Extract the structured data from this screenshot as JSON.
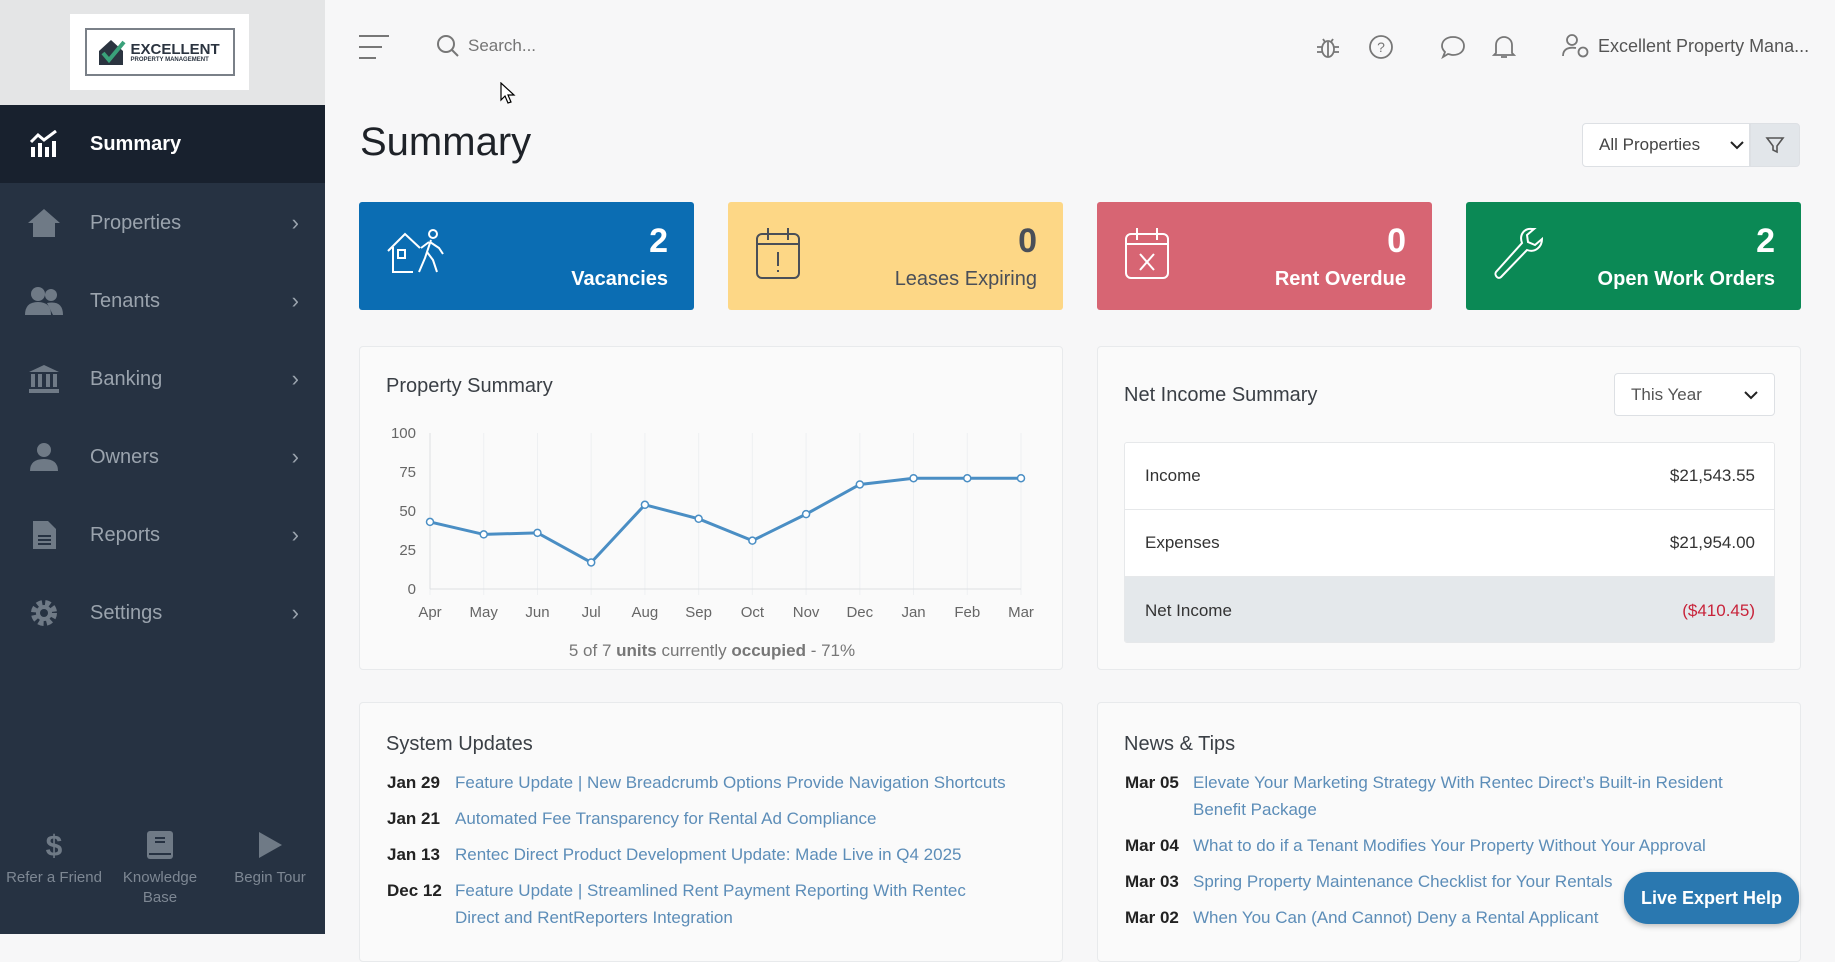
{
  "logo": {
    "line1": "EXCELLENT",
    "line2": "PROPERTY MANAGEMENT"
  },
  "sidebar": {
    "items": [
      {
        "label": "Summary",
        "icon": "chart-icon"
      },
      {
        "label": "Properties",
        "icon": "home-icon"
      },
      {
        "label": "Tenants",
        "icon": "users-icon"
      },
      {
        "label": "Banking",
        "icon": "bank-icon"
      },
      {
        "label": "Owners",
        "icon": "owner-icon"
      },
      {
        "label": "Reports",
        "icon": "document-icon"
      },
      {
        "label": "Settings",
        "icon": "gear-icon"
      }
    ],
    "footer": [
      {
        "label": "Refer a Friend",
        "icon": "dollar-icon"
      },
      {
        "label": "Knowledge Base",
        "icon": "book-icon"
      },
      {
        "label": "Begin Tour",
        "icon": "play-icon"
      }
    ]
  },
  "header": {
    "search_placeholder": "Search...",
    "user": "Excellent Property Mana..."
  },
  "page": {
    "title": "Summary",
    "property_filter": "All Properties"
  },
  "cards": [
    {
      "value": "2",
      "label": "Vacancies",
      "color": "#0b6db3"
    },
    {
      "value": "0",
      "label": "Leases Expiring",
      "color": "#fdd786"
    },
    {
      "value": "0",
      "label": "Rent Overdue",
      "color": "#d76573"
    },
    {
      "value": "2",
      "label": "Open Work Orders",
      "color": "#0b8955"
    }
  ],
  "property_summary": {
    "title": "Property Summary",
    "occupancy": {
      "pre": "5 of 7 ",
      "units": "units",
      "mid": " currently ",
      "occupied": "occupied",
      "post": " - 71%"
    }
  },
  "chart_data": {
    "type": "line",
    "title": "Property Summary",
    "categories": [
      "Apr",
      "May",
      "Jun",
      "Jul",
      "Aug",
      "Sep",
      "Oct",
      "Nov",
      "Dec",
      "Jan",
      "Feb",
      "Mar"
    ],
    "values": [
      43,
      35,
      36,
      17,
      54,
      45,
      31,
      48,
      67,
      71,
      71,
      71
    ],
    "ylim": [
      0,
      100
    ],
    "yticks": [
      "0",
      "25",
      "50",
      "75",
      "100"
    ],
    "color": "#4a8ec4"
  },
  "net_income": {
    "title": "Net Income Summary",
    "period": "This Year",
    "rows": [
      {
        "label": "Income",
        "value": "$21,543.55"
      },
      {
        "label": "Expenses",
        "value": "$21,954.00"
      },
      {
        "label": "Net Income",
        "value": "($410.45)"
      }
    ]
  },
  "system_updates": {
    "title": "System Updates",
    "items": [
      {
        "date": "Jan 29",
        "text": "Feature Update | New Breadcrumb Options Provide Navigation Shortcuts"
      },
      {
        "date": "Jan 21",
        "text": "Automated Fee Transparency for Rental Ad Compliance"
      },
      {
        "date": "Jan 13",
        "text": "Rentec Direct Product Development Update: Made Live in Q4 2025"
      },
      {
        "date": "Dec 12",
        "text": "Feature Update | Streamlined Rent Payment Reporting With Rentec Direct and RentReporters Integration"
      }
    ]
  },
  "news": {
    "title": "News & Tips",
    "items": [
      {
        "date": "Mar 05",
        "text": "Elevate Your Marketing Strategy With Rentec Direct’s Built-in Resident Benefit Package"
      },
      {
        "date": "Mar 04",
        "text": "What to do if a Tenant Modifies Your Property Without Your Approval"
      },
      {
        "date": "Mar 03",
        "text": "Spring Property Maintenance Checklist for Your Rentals"
      },
      {
        "date": "Mar 02",
        "text": "When You Can (And Cannot) Deny a Rental Applicant"
      }
    ]
  },
  "help_button": "Live Expert Help"
}
